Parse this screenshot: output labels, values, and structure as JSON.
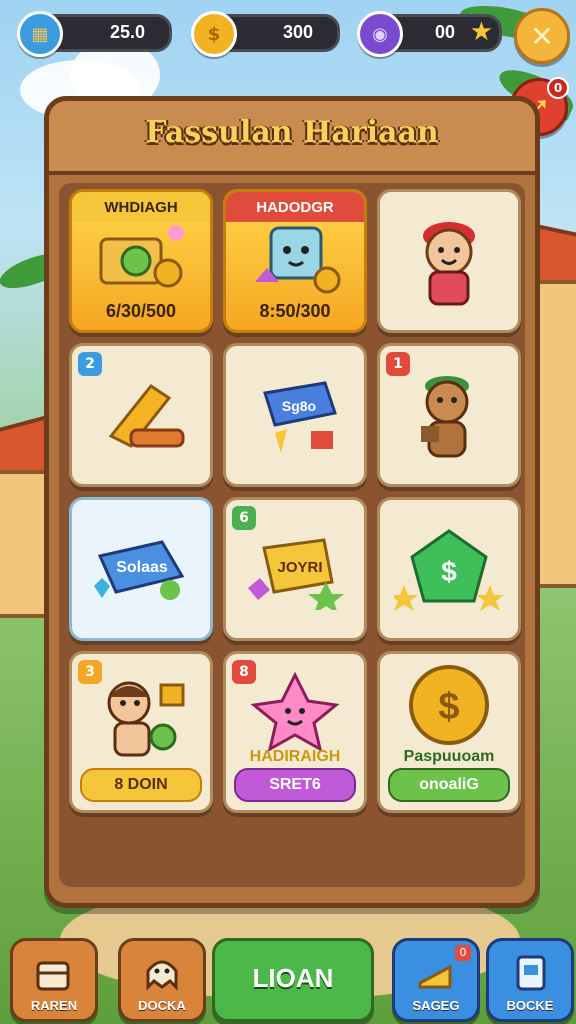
{
  "resources": [
    {
      "name": "crate",
      "value": "25.0",
      "icon": "crate-icon",
      "color": "#3a9be0"
    },
    {
      "name": "coin",
      "value": "300",
      "icon": "coin-icon",
      "color": "#f2b322"
    },
    {
      "name": "gem",
      "value": "00",
      "icon": "gem-icon",
      "color": "#7a4bd1"
    }
  ],
  "top_buttons": {
    "close_icon": "close-icon",
    "share_icon": "share-icon",
    "notification_count": "0"
  },
  "panel": {
    "title": "Fassulan Hariaan"
  },
  "cards": [
    {
      "title": "WHDIAGH",
      "footer": "6/30/500",
      "style": "gold"
    },
    {
      "title": "HADODGR",
      "footer": "8:50/300",
      "style": "gold-red"
    },
    {
      "title": ""
    },
    {
      "badge": "2"
    },
    {
      "art_text": "Sg8o"
    },
    {
      "badge": "1"
    },
    {
      "art_text": "Solaas"
    },
    {
      "badge": "6",
      "art_text": "JOYRI"
    },
    {
      "art_text": "$"
    },
    {
      "badge": "3",
      "pill": "8 DOIN"
    },
    {
      "badge": "8",
      "caption": "HADIRAIGH",
      "pill": "SRET6"
    },
    {
      "art_text": "$",
      "caption": "Paspuuoam",
      "pill": "onoaliG"
    }
  ],
  "nav": [
    {
      "label": "RAREN",
      "icon": "box-icon"
    },
    {
      "label": "DOCKA",
      "icon": "ghost-icon"
    },
    {
      "label": "LIOAN",
      "icon": ""
    },
    {
      "label": "SAGEG",
      "icon": "cheese-icon",
      "badge": "0"
    },
    {
      "label": "BOCKE",
      "icon": "card-icon"
    }
  ]
}
